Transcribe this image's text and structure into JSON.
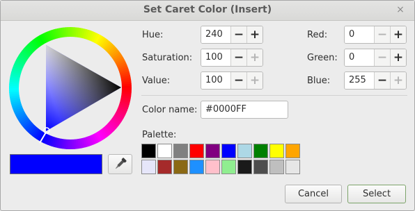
{
  "window": {
    "title": "Set Caret Color (Insert)",
    "close_glyph": "×"
  },
  "color_wheel": {
    "hue": 240,
    "selected_color": "#0000FF"
  },
  "current_color": "#0000FF",
  "hsv": [
    {
      "label": "Hue:",
      "value": "240",
      "minus_enabled": true,
      "plus_enabled": true
    },
    {
      "label": "Saturation:",
      "value": "100",
      "minus_enabled": true,
      "plus_enabled": false
    },
    {
      "label": "Value:",
      "value": "100",
      "minus_enabled": true,
      "plus_enabled": false
    }
  ],
  "rgb": [
    {
      "label": "Red:",
      "value": "0",
      "minus_enabled": false,
      "plus_enabled": true
    },
    {
      "label": "Green:",
      "value": "0",
      "minus_enabled": false,
      "plus_enabled": true
    },
    {
      "label": "Blue:",
      "value": "255",
      "minus_enabled": true,
      "plus_enabled": false
    }
  ],
  "spin_glyphs": {
    "minus": "−",
    "plus": "+"
  },
  "color_name": {
    "label": "Color name:",
    "value": "#0000FF"
  },
  "palette": {
    "label": "Palette:",
    "colors": [
      "#000000",
      "#FFFFFF",
      "#808080",
      "#FF0000",
      "#800080",
      "#0000FF",
      "#ADD8E6",
      "#008000",
      "#FFFF00",
      "#FFA500",
      "#E6E6FA",
      "#A52A2A",
      "#8B6914",
      "#1E90FF",
      "#FFC0CB",
      "#90EE90",
      "#1A1A1A",
      "#4D4D4D",
      "#BFBFBF",
      "#E6E6E6"
    ]
  },
  "buttons": {
    "cancel": "Cancel",
    "select": "Select"
  },
  "icons": {
    "eyedropper": "eyedropper-icon",
    "close": "close-icon"
  }
}
